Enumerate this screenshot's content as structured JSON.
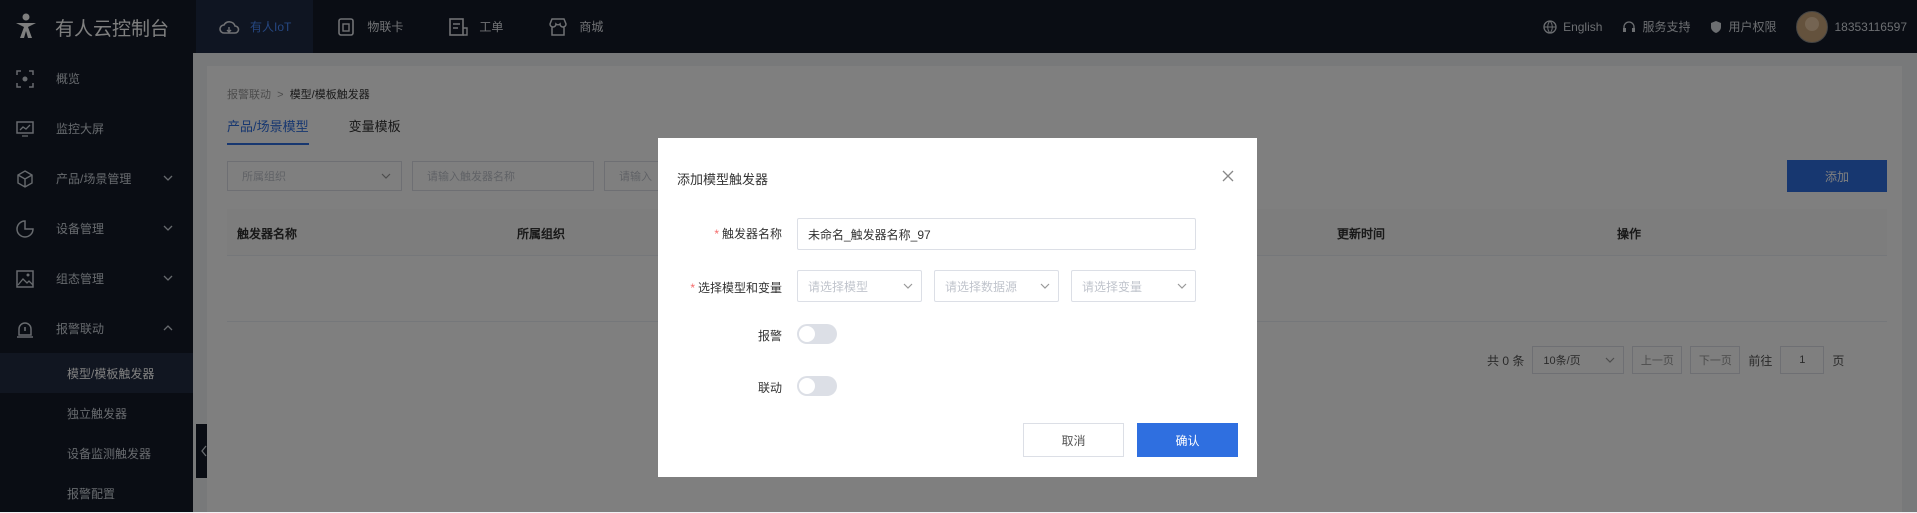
{
  "header": {
    "brand": "有人云控制台",
    "nav": [
      {
        "label": "有人IoT",
        "icon": "cloud-icon",
        "active": true
      },
      {
        "label": "物联卡",
        "icon": "sim-card-icon",
        "active": false
      },
      {
        "label": "工单",
        "icon": "work-order-icon",
        "active": false
      },
      {
        "label": "商城",
        "icon": "store-icon",
        "active": false
      }
    ],
    "language": "English",
    "support": "服务支持",
    "permissions": "用户权限",
    "user": "18353116597"
  },
  "sidebar": {
    "items": [
      {
        "label": "概览",
        "icon": "overview-icon"
      },
      {
        "label": "监控大屏",
        "icon": "monitor-icon"
      },
      {
        "label": "产品/场景管理",
        "icon": "cube-icon",
        "chevron": "down"
      },
      {
        "label": "设备管理",
        "icon": "pie-chart-icon",
        "chevron": "down"
      },
      {
        "label": "组态管理",
        "icon": "image-icon",
        "chevron": "down"
      },
      {
        "label": "报警联动",
        "icon": "alarm-icon",
        "chevron": "up"
      }
    ],
    "subitems": [
      {
        "label": "模型/模板触发器",
        "active": true
      },
      {
        "label": "独立触发器",
        "active": false
      },
      {
        "label": "设备监测触发器",
        "active": false
      },
      {
        "label": "报警配置",
        "active": false
      }
    ]
  },
  "main": {
    "breadcrumb": {
      "parent": "报警联动",
      "separator": ">",
      "current": "模型/模板触发器"
    },
    "tabs": [
      {
        "label": "产品/场景模型",
        "active": true
      },
      {
        "label": "变量模板",
        "active": false
      }
    ],
    "filters": {
      "org_placeholder": "所属组织",
      "name_placeholder": "请输入触发器名称",
      "other_placeholder": "请输入"
    },
    "add_button": "添加",
    "table_headers": [
      "触发器名称",
      "所属组织",
      "更新时间",
      "操作"
    ],
    "pagination": {
      "total": "共 0 条",
      "page_size": "10条/页",
      "prev": "上一页",
      "next": "下一页",
      "goto_label": "前往",
      "page": "1",
      "page_suffix": "页"
    }
  },
  "dialog": {
    "title": "添加模型触发器",
    "name_label": "触发器名称",
    "name_value": "未命名_触发器名称_97",
    "model_label": "选择模型和变量",
    "select_model": "请选择模型",
    "select_datasource": "请选择数据源",
    "select_variable": "请选择变量",
    "alarm_label": "报警",
    "alarm_on": false,
    "linkage_label": "联动",
    "linkage_on": false,
    "cancel": "取消",
    "confirm": "确认"
  },
  "colors": {
    "primary": "#2f6fe0",
    "topbar": "#141b29",
    "required": "#f56c6c"
  }
}
